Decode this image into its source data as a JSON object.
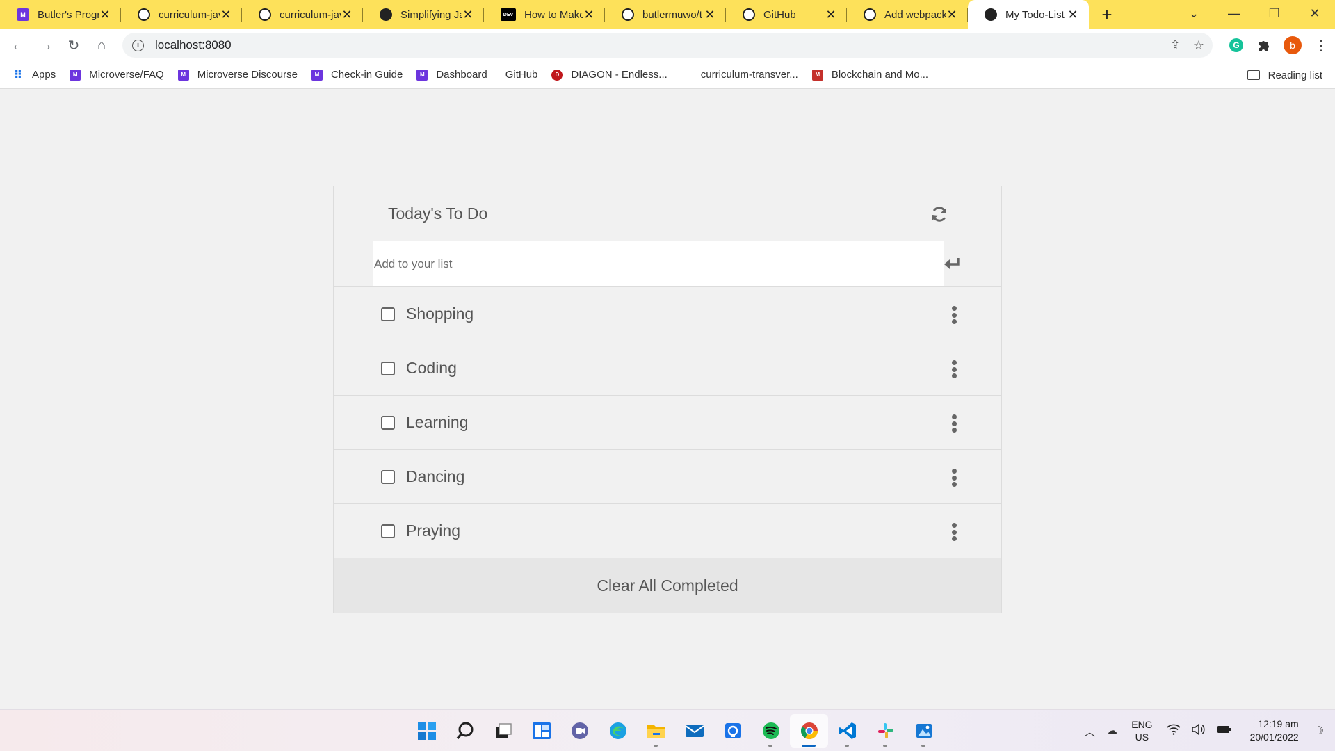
{
  "browser": {
    "tabs": [
      {
        "title": "Butler's Progre",
        "icon": "microverse-icon",
        "active": false
      },
      {
        "title": "curriculum-jav",
        "icon": "github-icon",
        "active": false
      },
      {
        "title": "curriculum-jav",
        "icon": "github-icon",
        "active": false
      },
      {
        "title": "Simplifying Ja",
        "icon": "globe-icon",
        "active": false
      },
      {
        "title": "How to Make",
        "icon": "dev-icon",
        "active": false
      },
      {
        "title": "butlermuwo/t",
        "icon": "github-icon",
        "active": false
      },
      {
        "title": "GitHub",
        "icon": "github-icon",
        "active": false
      },
      {
        "title": "Add webpack",
        "icon": "github-icon",
        "active": false
      },
      {
        "title": "My Todo-List",
        "icon": "globe-icon",
        "active": true
      }
    ],
    "dev_favicon_text": "DEV",
    "url": "localhost:8080",
    "avatar_letter": "b",
    "grammarly_letter": "G",
    "bookmarks": [
      {
        "label": "Apps",
        "icon": "apps-grid-icon"
      },
      {
        "label": "Microverse/FAQ",
        "icon": "microverse-icon"
      },
      {
        "label": "Microverse Discourse",
        "icon": "microverse-icon"
      },
      {
        "label": "Check-in Guide",
        "icon": "microverse-icon"
      },
      {
        "label": "Dashboard",
        "icon": "microverse-icon"
      },
      {
        "label": "GitHub",
        "icon": "none"
      },
      {
        "label": "DIAGON - Endless...",
        "icon": "diagon-icon"
      },
      {
        "label": "curriculum-transver...",
        "icon": "none"
      },
      {
        "label": "Blockchain and Mo...",
        "icon": "mit-icon"
      }
    ],
    "reading_list": "Reading list"
  },
  "todo": {
    "title": "Today's To Do",
    "input_placeholder": "Add to your list",
    "items": [
      {
        "label": "Shopping",
        "completed": false
      },
      {
        "label": "Coding",
        "completed": false
      },
      {
        "label": "Learning",
        "completed": false
      },
      {
        "label": "Dancing",
        "completed": false
      },
      {
        "label": "Praying",
        "completed": false
      }
    ],
    "clear_label": "Clear All Completed"
  },
  "taskbar": {
    "apps": [
      "start-icon",
      "search-icon",
      "task-view-icon",
      "widgets-icon",
      "teams-chat-icon",
      "edge-icon",
      "file-explorer-icon",
      "mail-icon",
      "store-icon",
      "spotify-icon",
      "chrome-icon",
      "vscode-icon",
      "slack-icon",
      "photos-icon"
    ],
    "language_line1": "ENG",
    "language_line2": "US",
    "time": "12:19 am",
    "date": "20/01/2022"
  }
}
